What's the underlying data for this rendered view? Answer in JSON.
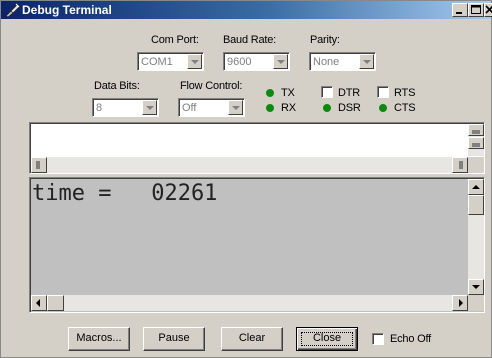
{
  "window": {
    "title": "Debug Terminal",
    "icon": "probe-icon",
    "controls": [
      "minimize",
      "maximize",
      "close"
    ]
  },
  "settings": {
    "com_port": {
      "label": "Com Port:",
      "value": "COM1"
    },
    "baud_rate": {
      "label": "Baud Rate:",
      "value": "9600"
    },
    "parity": {
      "label": "Parity:",
      "value": "None"
    },
    "data_bits": {
      "label": "Data Bits:",
      "value": "8"
    },
    "flow_control": {
      "label": "Flow Control:",
      "value": "Off"
    }
  },
  "indicators": {
    "tx": "TX",
    "rx": "RX",
    "dtr": "DTR",
    "rts": "RTS",
    "dsr": "DSR",
    "cts": "CTS",
    "led_color": "#0d8a0d"
  },
  "transmit_pane": {
    "text": ""
  },
  "receive_pane": {
    "text": "time =   02261"
  },
  "buttons": {
    "macros": "Macros...",
    "pause": "Pause",
    "clear": "Clear",
    "close": "Close"
  },
  "echo_off": {
    "label": "Echo Off",
    "checked": false
  }
}
